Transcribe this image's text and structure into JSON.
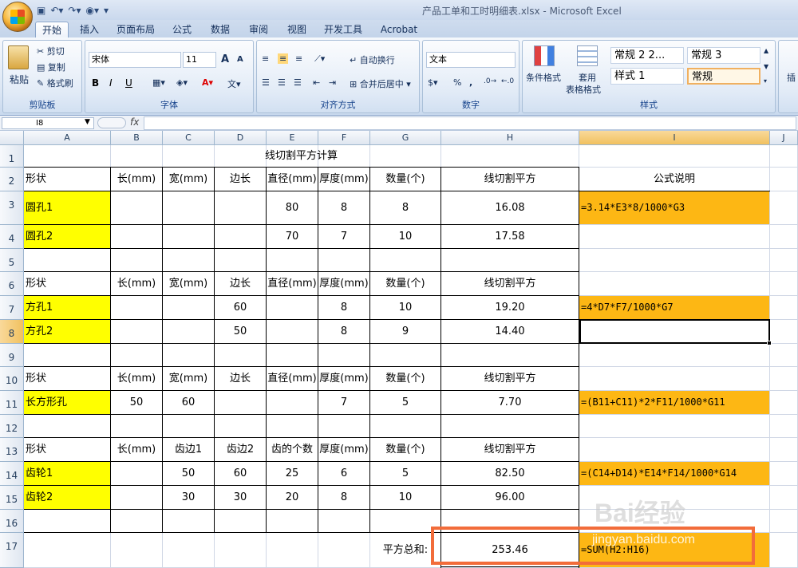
{
  "window": {
    "title": "产品工单和工时明细表.xlsx - Microsoft Excel"
  },
  "ribbon_tabs": [
    "开始",
    "插入",
    "页面布局",
    "公式",
    "数据",
    "审阅",
    "视图",
    "开发工具",
    "Acrobat"
  ],
  "clipboard": {
    "paste": "粘贴",
    "cut": "剪切",
    "copy": "复制",
    "format_painter": "格式刷",
    "label": "剪贴板"
  },
  "font": {
    "name": "宋体",
    "size": "11",
    "label": "字体",
    "grow": "A",
    "shrink": "A",
    "bold": "B",
    "italic": "I",
    "underline": "U"
  },
  "alignment": {
    "wrap": "自动换行",
    "merge": "合并后居中",
    "label": "对齐方式"
  },
  "number": {
    "format": "文本",
    "label": "数字",
    "percent": "%",
    "comma": ","
  },
  "styles": {
    "conditional": "条件格式",
    "table": "套用",
    "table2": "表格格式",
    "label": "样式",
    "items": [
      "常规 2 2...",
      "常规 3",
      "样式 1",
      "常规"
    ]
  },
  "insert": "插",
  "formula_bar": {
    "name_box": "I8",
    "fx": "fx",
    "value": ""
  },
  "columns": [
    "A",
    "B",
    "C",
    "D",
    "E",
    "F",
    "G",
    "H",
    "I",
    "J"
  ],
  "rows": [
    "1",
    "2",
    "3",
    "4",
    "5",
    "6",
    "7",
    "8",
    "9",
    "10",
    "11",
    "12",
    "13",
    "14",
    "15",
    "16",
    "17"
  ],
  "sheet": {
    "title": "线切割平方计算",
    "header1": [
      "形状",
      "长(mm)",
      "宽(mm)",
      "边长",
      "直径(mm)",
      "厚度(mm)",
      "数量(个)",
      "线切割平方"
    ],
    "header_formula": "公式说明",
    "r3": [
      "圆孔1",
      "",
      "",
      "",
      "80",
      "8",
      "8",
      "16.08"
    ],
    "r4": [
      "圆孔2",
      "",
      "",
      "",
      "70",
      "7",
      "10",
      "17.58"
    ],
    "header6": [
      "形状",
      "长(mm)",
      "宽(mm)",
      "边长",
      "直径(mm)",
      "厚度(mm)",
      "数量(个)",
      "线切割平方"
    ],
    "r7": [
      "方孔1",
      "",
      "",
      "60",
      "",
      "8",
      "10",
      "19.20"
    ],
    "r8": [
      "方孔2",
      "",
      "",
      "50",
      "",
      "8",
      "9",
      "14.40"
    ],
    "header10": [
      "形状",
      "长(mm)",
      "宽(mm)",
      "边长",
      "直径(mm)",
      "厚度(mm)",
      "数量(个)",
      "线切割平方"
    ],
    "r11": [
      "长方形孔",
      "50",
      "60",
      "",
      "",
      "7",
      "5",
      "7.70"
    ],
    "header13": [
      "形状",
      "长(mm)",
      "齿边1",
      "齿边2",
      "齿的个数",
      "厚度(mm)",
      "数量(个)",
      "线切割平方"
    ],
    "r14": [
      "齿轮1",
      "",
      "50",
      "60",
      "25",
      "6",
      "5",
      "82.50"
    ],
    "r15": [
      "齿轮2",
      "",
      "30",
      "30",
      "20",
      "8",
      "10",
      "96.00"
    ],
    "total_label": "平方总和:",
    "total_value": "253.46",
    "f3": "=3.14*E3*8/1000*G3",
    "f7": "=4*D7*F7/1000*G7",
    "f11": "=(B11+C11)*2*F11/1000*G11",
    "f14": "=(C14+D14)*E14*F14/1000*G14",
    "f17": "=SUM(H2:H16)"
  },
  "watermark": {
    "brand": "Bai经验",
    "url": "jingyan.baidu.com"
  },
  "colors": {
    "yellow": "#ffff00",
    "orange": "#fdb714",
    "highlight": "#f26c3a"
  }
}
